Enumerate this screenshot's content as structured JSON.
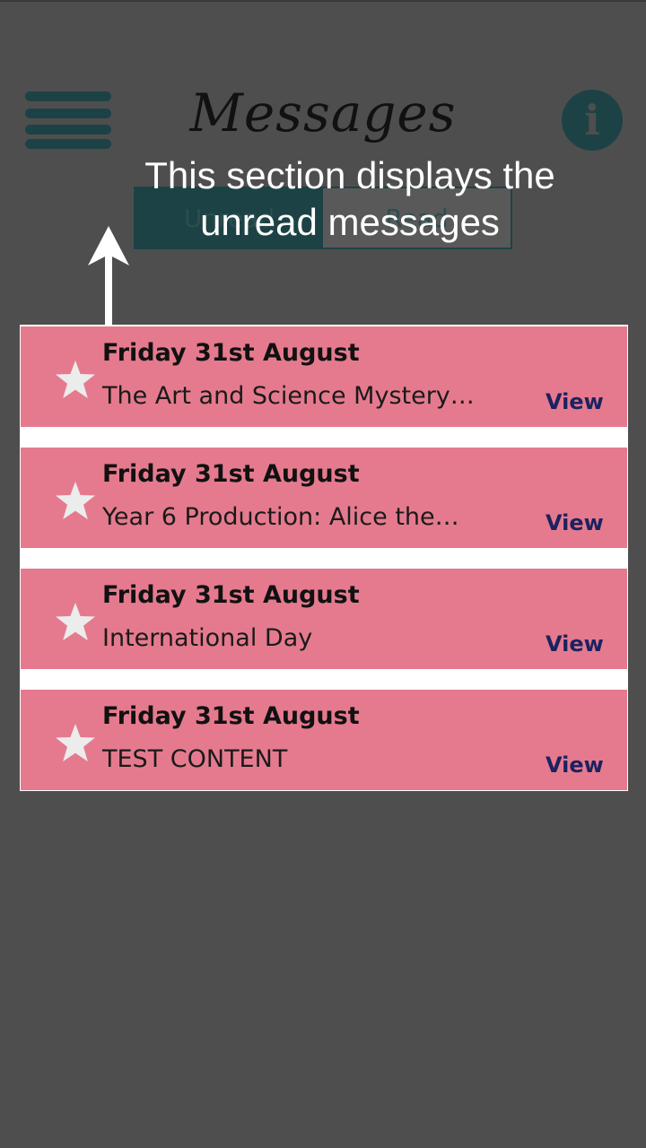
{
  "header": {
    "title": "Messages",
    "menu_icon": "hamburger-menu-icon",
    "info_icon": "info-icon",
    "info_glyph": "i"
  },
  "tabs": [
    {
      "label": "Unread",
      "active": true
    },
    {
      "label": "Read",
      "active": false
    }
  ],
  "tutorial": {
    "hint_line1": "This section displays the",
    "hint_line2": "unread messages",
    "arrow_icon": "arrow-up-icon"
  },
  "messages": [
    {
      "date": "Friday 31st August",
      "subject": "The Art and Science Mystery…",
      "action": "View",
      "star_icon": "star-icon"
    },
    {
      "date": "Friday 31st August",
      "subject": "Year 6 Production: Alice the…",
      "action": "View",
      "star_icon": "star-icon"
    },
    {
      "date": "Friday 31st August",
      "subject": "International Day",
      "action": "View",
      "star_icon": "star-icon"
    },
    {
      "date": "Friday 31st August",
      "subject": "TEST CONTENT",
      "action": "View",
      "star_icon": "star-icon"
    }
  ],
  "colors": {
    "background": "#4e4e4e",
    "accent": "#1d4245",
    "card": "#e57a8e",
    "link": "#1c2260"
  }
}
